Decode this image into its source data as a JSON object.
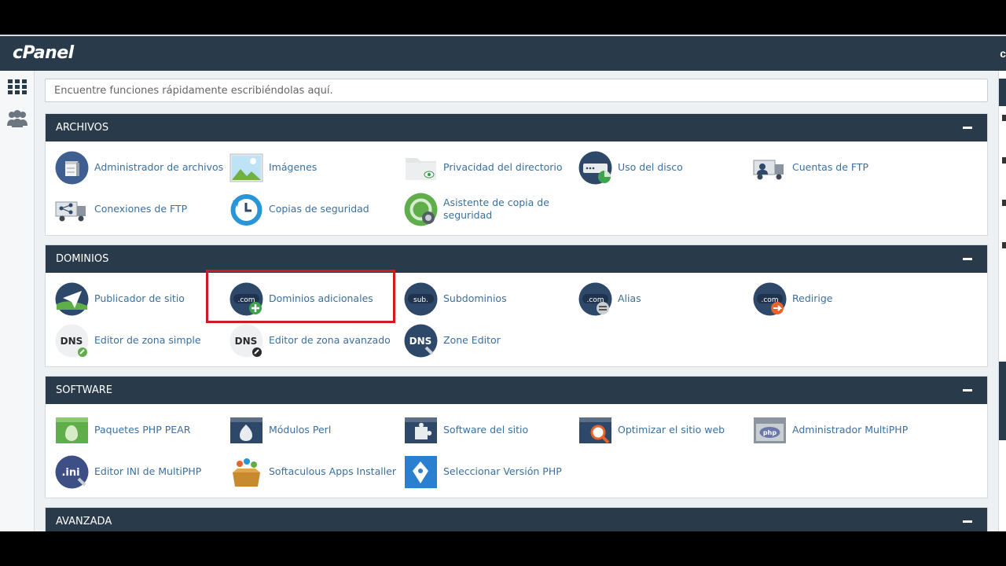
{
  "brand": {
    "logo": "cPanel"
  },
  "search": {
    "placeholder": "Encuentre funciones rápidamente escribiéndolas aquí."
  },
  "sections": {
    "archivos": {
      "title": "ARCHIVOS",
      "items": [
        "Administrador de archivos",
        "Imágenes",
        "Privacidad del directorio",
        "Uso del disco",
        "Cuentas de FTP",
        "Conexiones de FTP",
        "Copias de seguridad",
        "Asistente de copia de seguridad"
      ]
    },
    "dominios": {
      "title": "DOMINIOS",
      "items": [
        "Publicador de sitio",
        "Dominios adicionales",
        "Subdominios",
        "Alias",
        "Redirige",
        "Editor de zona simple",
        "Editor de zona avanzado",
        "Zone Editor"
      ]
    },
    "software": {
      "title": "SOFTWARE",
      "items": [
        "Paquetes PHP PEAR",
        "Módulos Perl",
        "Software del sitio",
        "Optimizar el sitio web",
        "Administrador MultiPHP",
        "Editor INI de MultiPHP",
        "Softaculous Apps Installer",
        "Seleccionar Versión PHP"
      ]
    },
    "avanzada": {
      "title": "AVANZADA"
    }
  },
  "icon_text": {
    "com": ".com",
    "sub": "sub.",
    "dns": "DNS",
    "ini": ".ini",
    "php": "php"
  },
  "colors": {
    "header": "#293a4a",
    "link": "#3a6f9f",
    "highlight": "#d11a20"
  }
}
